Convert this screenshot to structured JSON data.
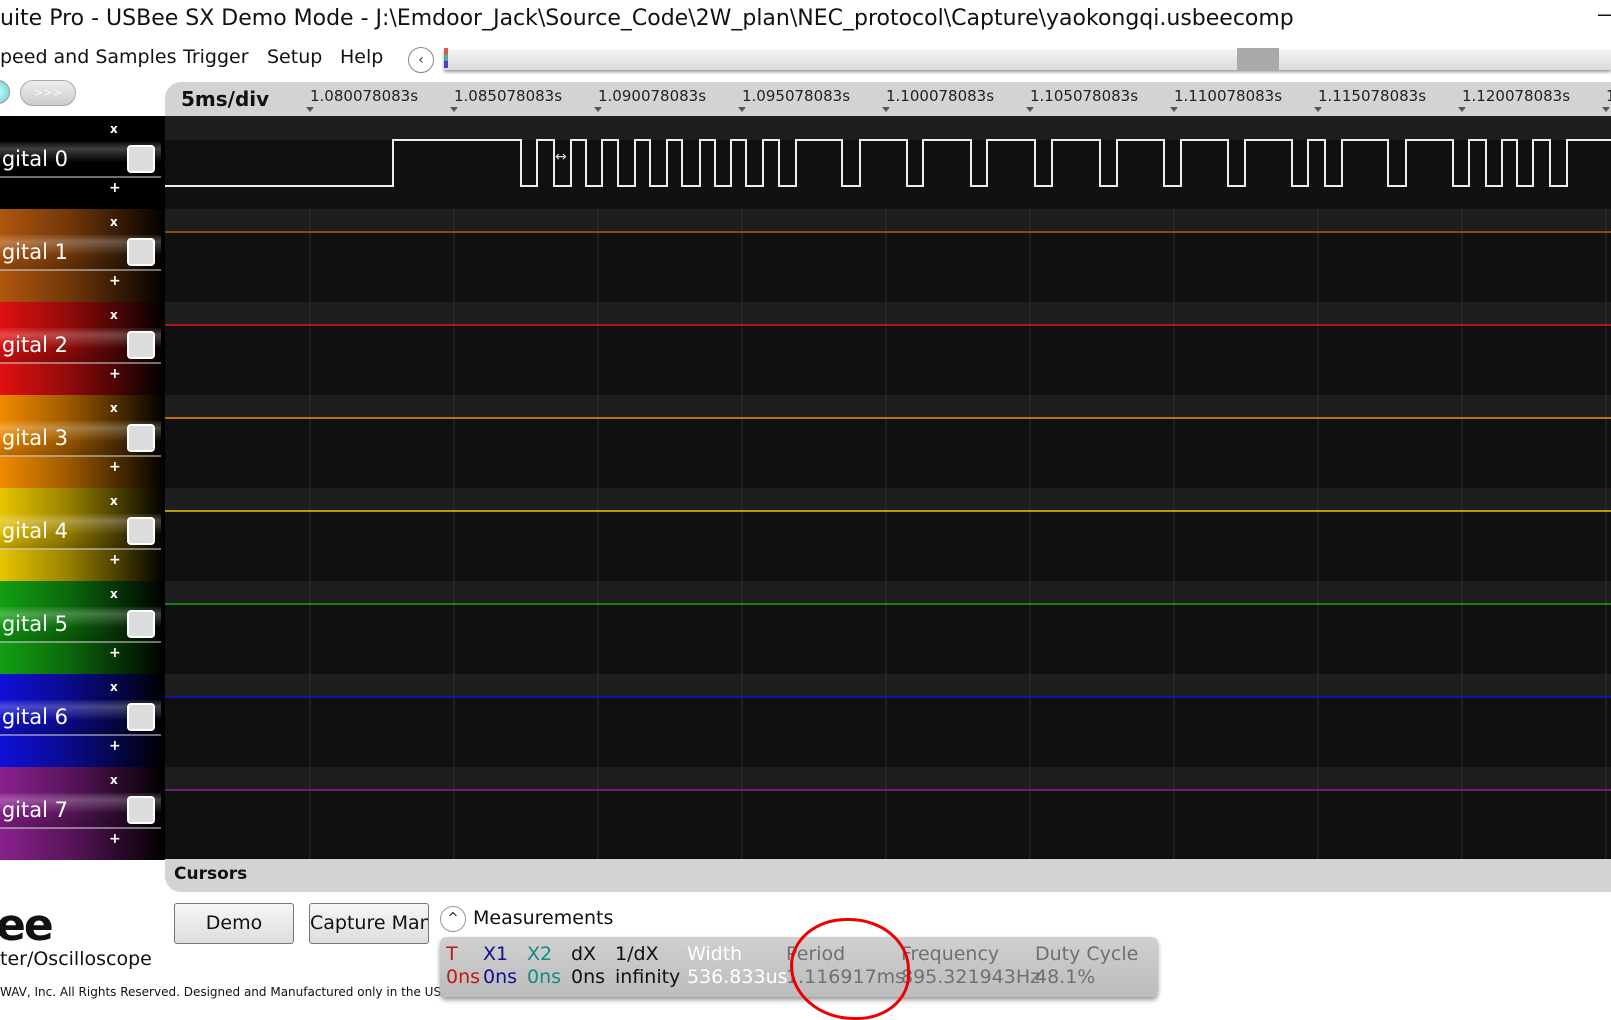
{
  "window": {
    "title": "uite Pro - USBee SX Demo Mode - J:\\Emdoor_Jack\\Source_Code\\2W_plan\\NEC_protocol\\Capture\\yaokongqi.usbeecomp",
    "minimize": "—"
  },
  "menu": [
    "peed and Samples",
    "Trigger",
    "Setup",
    "Help"
  ],
  "toolbar": {
    "back_icon": "‹",
    "run_label": ">>>"
  },
  "timebase": {
    "div": "5ms/div",
    "ticks": [
      "1.080078083s",
      "1.085078083s",
      "1.090078083s",
      "1.095078083s",
      "1.100078083s",
      "1.105078083s",
      "1.110078083s",
      "1.115078083s",
      "1.120078083s",
      "1"
    ]
  },
  "channels": [
    {
      "name": "igital 0",
      "color": "#bdbdbd"
    },
    {
      "name": "igital 1",
      "color": "#b0560f"
    },
    {
      "name": "igital 2",
      "color": "#e01010"
    },
    {
      "name": "igital 3",
      "color": "#f08a00"
    },
    {
      "name": "igital 4",
      "color": "#e8c400"
    },
    {
      "name": "igital 5",
      "color": "#12a012"
    },
    {
      "name": "igital 6",
      "color": "#1010d8"
    },
    {
      "name": "igital 7",
      "color": "#8a208e"
    }
  ],
  "channel_controls": {
    "remove": "x",
    "add": "+"
  },
  "cursors": {
    "title": "Cursors"
  },
  "buttons": {
    "demo": "Demo",
    "capture": "Capture Man"
  },
  "branding": {
    "logo": "ee",
    "subtitle": "ter/Oscilloscope",
    "copyright": "WAV, Inc. All Rights Reserved. Designed and Manufactured only in the USA!"
  },
  "measurements": {
    "toggle_icon": "^",
    "title": "Measurements",
    "items": [
      {
        "label": "T",
        "value": "0ns",
        "color": "#c01818"
      },
      {
        "label": "X1",
        "value": "0ns",
        "color": "#101090"
      },
      {
        "label": "X2",
        "value": "0ns",
        "color": "#108a8a"
      },
      {
        "label": "dX",
        "value": "0ns",
        "color": "#111111"
      },
      {
        "label": "1/dX",
        "value": "infinity",
        "color": "#111111"
      },
      {
        "label": "Width",
        "value": "536.833us",
        "color": "#ffffff"
      },
      {
        "label": "Period",
        "value": "1.116917ms",
        "color": "#707070"
      },
      {
        "label": "Frequency",
        "value": "895.321943Hz",
        "color": "#707070"
      },
      {
        "label": "Duty Cycle",
        "value": "48.1%",
        "color": "#707070"
      }
    ]
  }
}
